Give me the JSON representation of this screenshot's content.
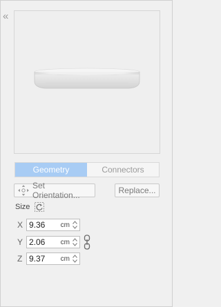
{
  "panel": {
    "collapse_icon": "double-chevron-left-icon",
    "tabs": [
      {
        "label": "Geometry",
        "active": true
      },
      {
        "label": "Connectors",
        "active": false
      }
    ],
    "buttons": {
      "set_orientation": "Set Orientation...",
      "replace": "Replace..."
    },
    "size": {
      "label": "Size",
      "fields": [
        {
          "axis": "X",
          "value": "9.36",
          "unit": "cm"
        },
        {
          "axis": "Y",
          "value": "2.06",
          "unit": "cm"
        },
        {
          "axis": "Z",
          "value": "9.37",
          "unit": "cm"
        }
      ]
    }
  },
  "colors": {
    "active_tab": "#a8ccf4",
    "panel_bg": "#f0f0f0",
    "model": "#e6e6e6"
  }
}
